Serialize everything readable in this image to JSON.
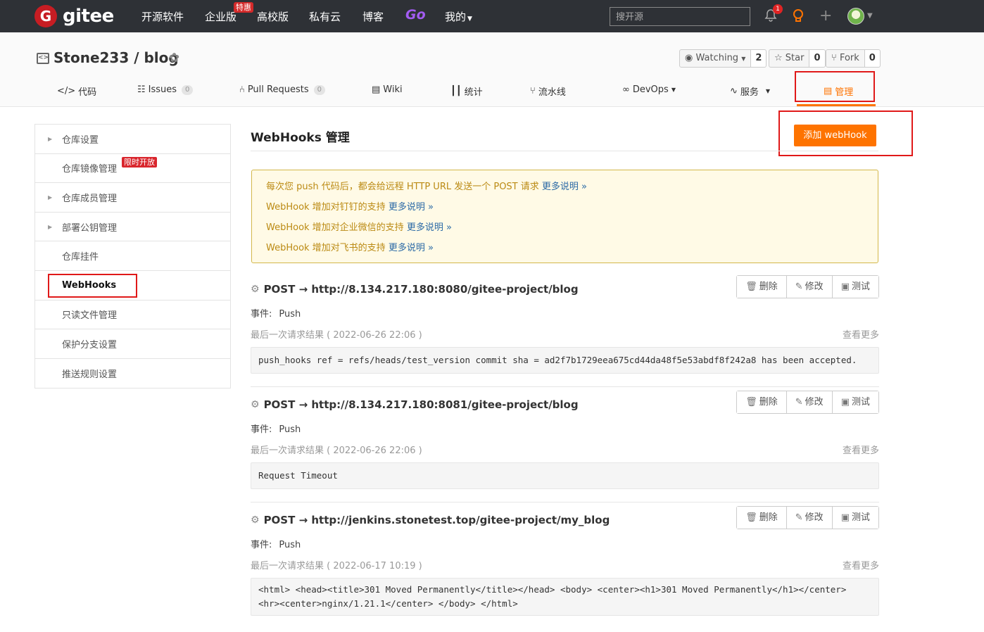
{
  "topnav": {
    "logo_letter": "G",
    "logo_text": "gitee",
    "items": [
      "开源软件",
      "企业版",
      "高校版",
      "私有云",
      "博客",
      "Go",
      "我的"
    ],
    "tejia_badge": "特惠",
    "search_placeholder": "搜开源",
    "notification_count": "1"
  },
  "repo": {
    "title": "Stone233 / blog",
    "watching_label": "Watching",
    "watching_count": "2",
    "star_label": "Star",
    "star_count": "0",
    "fork_label": "Fork",
    "fork_count": "0",
    "tabs": [
      {
        "label": "代码"
      },
      {
        "label": "Issues",
        "count": "0"
      },
      {
        "label": "Pull Requests",
        "count": "0"
      },
      {
        "label": "Wiki"
      },
      {
        "label": "统计"
      },
      {
        "label": "流水线"
      },
      {
        "label": "DevOps"
      },
      {
        "label": "服务"
      },
      {
        "label": "管理"
      }
    ]
  },
  "sidebar": {
    "items": [
      "仓库设置",
      "仓库镜像管理",
      "仓库成员管理",
      "部署公钥管理",
      "仓库挂件",
      "WebHooks",
      "只读文件管理",
      "保护分支设置",
      "推送规则设置"
    ],
    "limited_badge": "限时开放"
  },
  "main": {
    "title": "WebHooks 管理",
    "add_button": "添加 webHook",
    "notice": [
      {
        "text": "每次您 push 代码后，都会给远程 HTTP URL 发送一个 POST 请求 ",
        "link": "更多说明 »"
      },
      {
        "text": "WebHook 增加对钉钉的支持 ",
        "link": "更多说明 »"
      },
      {
        "text": "WebHook 增加对企业微信的支持 ",
        "link": "更多说明 »"
      },
      {
        "text": "WebHook 增加对飞书的支持 ",
        "link": "更多说明 »"
      }
    ],
    "button_labels": {
      "delete": "删除",
      "edit": "修改",
      "test": "测试"
    },
    "event_label": "事件:",
    "last_result_label": "最后一次请求结果",
    "view_more": "查看更多",
    "hooks": [
      {
        "url": "POST → http://8.134.217.180:8080/gitee-project/blog",
        "event": "Push",
        "time": "( 2022-06-26 22:06 )",
        "result": "push_hooks ref = refs/heads/test_version commit sha = ad2f7b1729eea675cd44da48f5e53abdf8f242a8 has been accepted."
      },
      {
        "url": "POST → http://8.134.217.180:8081/gitee-project/blog",
        "event": "Push",
        "time": "( 2022-06-26 22:06 )",
        "result": "Request Timeout"
      },
      {
        "url": "POST → http://jenkins.stonetest.top/gitee-project/my_blog",
        "event": "Push",
        "time": "( 2022-06-17 10:19 )",
        "result": "<html> <head><title>301 Moved Permanently</title></head> <body> <center><h1>301 Moved Permanently</h1></center> <hr><center>nginx/1.21.1</center> </body> </html>"
      }
    ]
  },
  "colors": {
    "accent": "#fe7300",
    "topbar": "#2e3136",
    "highlight_box": "#e01919"
  }
}
